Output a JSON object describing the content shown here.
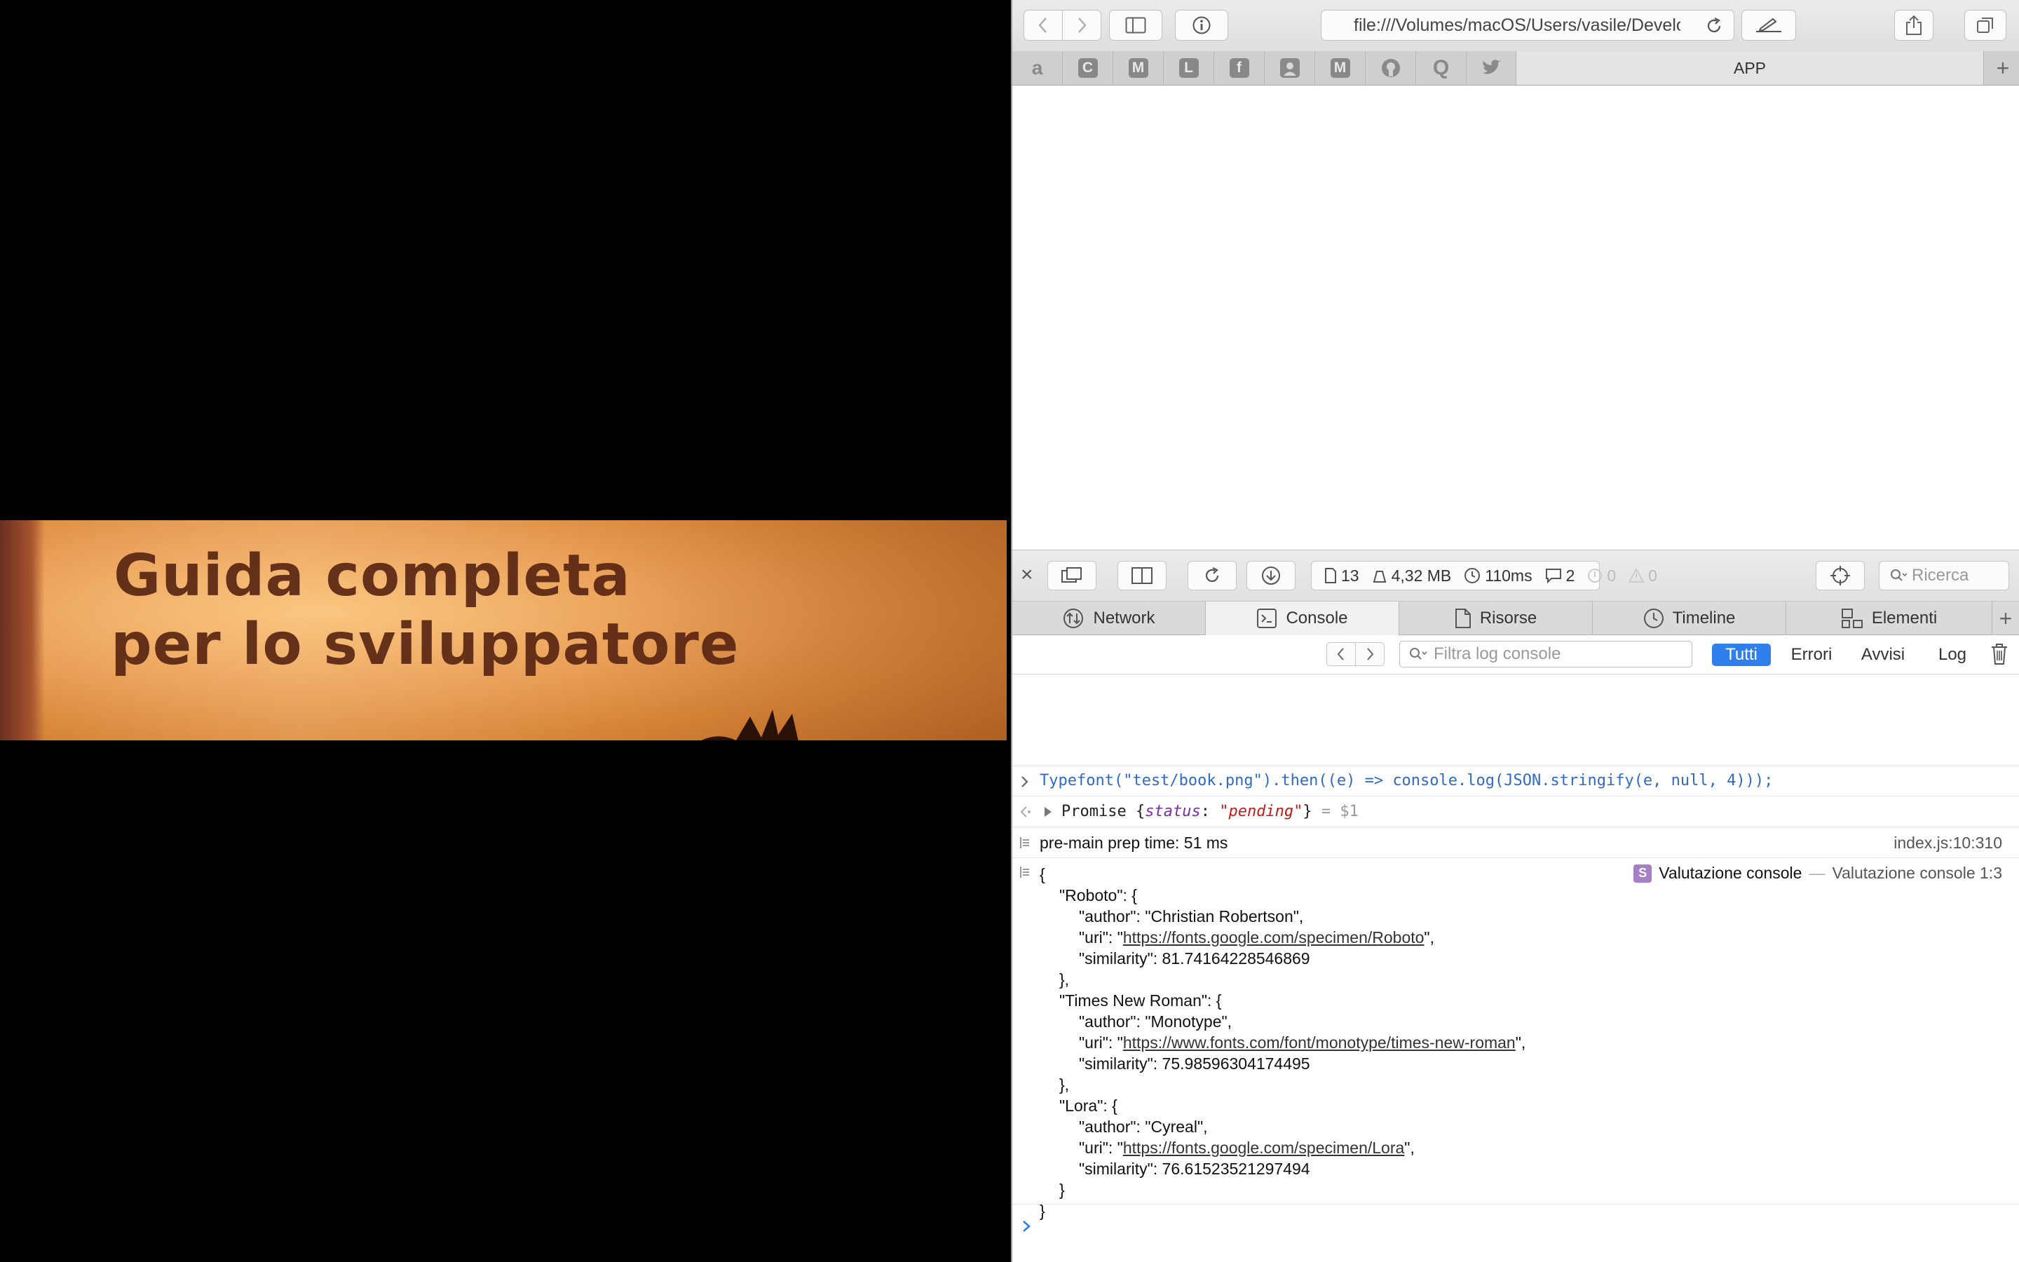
{
  "photo": {
    "line1": "Guida completa",
    "line2": "per lo sviluppatore"
  },
  "browser": {
    "address": "file:///Volumes/macOS/Users/vasile/Develo",
    "favorites": [
      {
        "icon": "amazon-icon",
        "glyph": "a"
      },
      {
        "icon": "c-icon",
        "glyph": "C"
      },
      {
        "icon": "m-icon",
        "glyph": "M"
      },
      {
        "icon": "l-icon",
        "glyph": "L"
      },
      {
        "icon": "facebook-icon",
        "glyph": "f"
      },
      {
        "icon": "user-icon",
        "glyph": ""
      },
      {
        "icon": "gmail-icon",
        "glyph": "M"
      },
      {
        "icon": "github-icon",
        "glyph": ""
      },
      {
        "icon": "q-icon",
        "glyph": "Q"
      },
      {
        "icon": "twitter-icon",
        "glyph": ""
      }
    ],
    "tab_label": "APP"
  },
  "inspector": {
    "stats": {
      "resources": "13",
      "size": "4,32 MB",
      "time": "110ms",
      "logs": "2",
      "errors": "0",
      "warnings": "0"
    },
    "search_placeholder": "Ricerca",
    "tabs": [
      {
        "label": "Network",
        "icon": "network-icon"
      },
      {
        "label": "Console",
        "icon": "console-icon"
      },
      {
        "label": "Risorse",
        "icon": "resources-icon"
      },
      {
        "label": "Timeline",
        "icon": "timeline-icon"
      },
      {
        "label": "Elementi",
        "icon": "elements-icon"
      }
    ],
    "active_tab": "Console",
    "filter_placeholder": "Filtra log console",
    "levels": [
      "Tutti",
      "Errori",
      "Avvisi",
      "Log"
    ]
  },
  "console": {
    "command": "Typefont(\"test/book.png\").then((e) => console.log(JSON.stringify(e, null, 4)));",
    "result": {
      "type": "Promise",
      "key": "status",
      "value": "\"pending\"",
      "ref": "= $1"
    },
    "log_message": "pre-main prep time: 51 ms",
    "log_source": "index.js:10:310",
    "eval_name": "Valutazione console",
    "eval_source": "Valutazione console 1:3",
    "json_output": [
      {
        "name": "Roboto",
        "author": "Christian Robertson",
        "uri": "https://fonts.google.com/specimen/Roboto",
        "similarity": "81.74164228546869"
      },
      {
        "name": "Times New Roman",
        "author": "Monotype",
        "uri": "https://www.fonts.com/font/monotype/times-new-roman",
        "similarity": "75.98596304174495"
      },
      {
        "name": "Lora",
        "author": "Cyreal",
        "uri": "https://fonts.google.com/specimen/Lora",
        "similarity": "76.61523521297494"
      }
    ]
  }
}
